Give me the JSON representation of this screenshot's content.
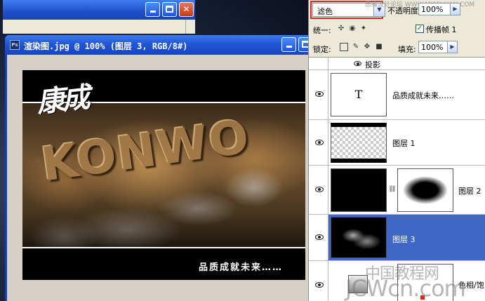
{
  "doc_window": {
    "title": "渲染图.jpg @ 100% (图层 3, RGB/8#)",
    "ps_icon": "Ps"
  },
  "canvas": {
    "logo_text": "康成",
    "embossed_text": "KONWO",
    "slogan": "品质成就未来……"
  },
  "panel": {
    "blend_mode": "滤色",
    "opacity_label": "不透明度:",
    "opacity_value": "100%",
    "unify_label": "统一:",
    "propagate_label": "传播帧 1",
    "lock_label": "锁定:",
    "fill_label": "填充:",
    "fill_value": "100%",
    "site_watermark": "思缘设计论坛 WWW.MISSYUAN.COM"
  },
  "layers": {
    "effect_label": "投影",
    "items": [
      {
        "name": "品质成就未来……",
        "thumb_text": "T"
      },
      {
        "name": "图层 1"
      },
      {
        "name": "图层 2"
      },
      {
        "name": "图层 3"
      },
      {
        "name": "色相/饱"
      }
    ]
  },
  "watermark": {
    "text_cn": "中国教程网",
    "text_en": "JCWcn.com"
  },
  "colors": {
    "titlebar": "#2056d6",
    "selection": "#3e67c7",
    "highlight_outline": "#e2241d"
  }
}
